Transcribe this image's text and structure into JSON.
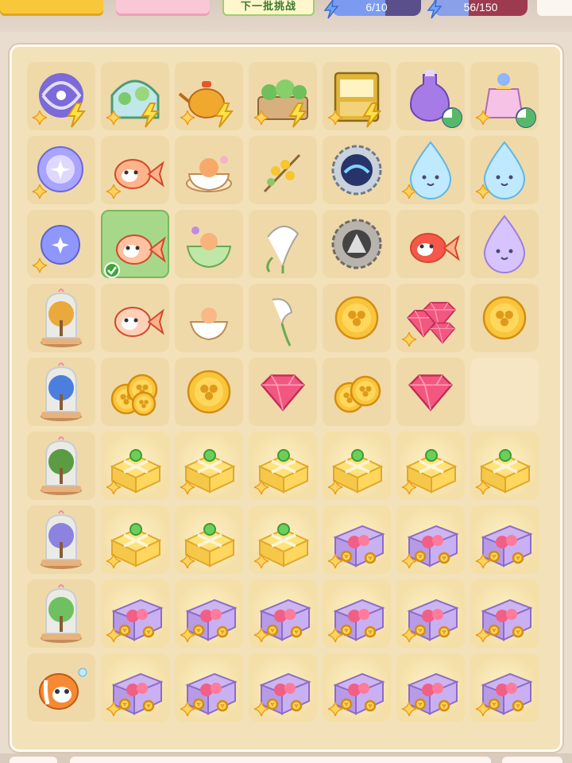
{
  "header": {
    "challenge_label": "下一批挑战",
    "energy_text": "6/10",
    "energy_fraction": 0.6,
    "xp_text": "56/150",
    "xp_fraction": 0.373
  },
  "board": {
    "rows": [
      [
        "galaxy-swirl",
        "greenhouse-dome",
        "golden-teapot",
        "garden-planter",
        "golden-cabinet",
        "purple-potion",
        "crowned-perfume"
      ],
      [
        "cosmic-orb",
        "koi-fish-plush",
        "cat-in-teacup",
        "osmanthus-branch",
        "water-portal-gear",
        "water-droplet-spirit",
        "water-droplet-spirit"
      ],
      [
        "cosmic-orb-small",
        "koi-fish",
        "cat-in-green-cup",
        "calla-lily-bouquet",
        "stone-rune-gear",
        "red-goldfish",
        "purple-droplet-spirit"
      ],
      [
        "golden-tree-jar",
        "koi-fish-small",
        "cat-teacup-small",
        "calla-lily",
        "clover-coin",
        "ruby-cluster",
        "clover-coin"
      ],
      [
        "blue-tree-jar",
        "coin-pile",
        "clover-coin",
        "ruby-gem",
        "coin-pair",
        "ruby-gem",
        "empty"
      ],
      [
        "bonsai-jar",
        "gift-box-yellow",
        "gift-box-yellow",
        "gift-box-yellow",
        "gift-box-yellow",
        "gift-box-yellow",
        "gift-box-yellow"
      ],
      [
        "lavender-jar",
        "gift-box-yellow",
        "gift-box-yellow",
        "gift-box-yellow",
        "treasure-chest",
        "treasure-chest",
        "treasure-chest"
      ],
      [
        "sprout-jar",
        "treasure-chest",
        "treasure-chest",
        "treasure-chest",
        "treasure-chest",
        "treasure-chest",
        "treasure-chest"
      ],
      [
        "clownfish-plush",
        "treasure-chest",
        "treasure-chest",
        "treasure-chest",
        "treasure-chest",
        "treasure-chest",
        "treasure-chest"
      ]
    ],
    "selected": [
      2,
      1
    ]
  },
  "colors": {
    "board_bg": "#f3e1b9",
    "cell_bg": "#efd9a9",
    "selected_bg": "#a7d88a",
    "energy_fill": "#7c9bf0"
  }
}
